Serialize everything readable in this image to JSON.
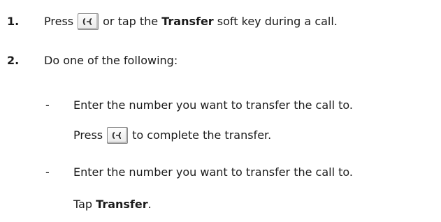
{
  "steps": [
    {
      "number": "1.",
      "before_key": "Press",
      "key_icon": "transfer-key-icon",
      "after_key": "or tap the ",
      "bold": "Transfer",
      "after_bold": " soft key during a call."
    },
    {
      "number": "2.",
      "text": "Do one of the following:"
    }
  ],
  "options": [
    {
      "dash": "-",
      "line1": "Enter the number you want to transfer the call to.",
      "line2_before": "Press",
      "key_icon": "transfer-key-icon",
      "line2_after": "to complete the transfer."
    },
    {
      "dash": "-",
      "line1": "Enter the number you want to transfer the call to.",
      "line2_before": "Tap ",
      "line2_bold": "Transfer",
      "line2_after": "."
    }
  ]
}
